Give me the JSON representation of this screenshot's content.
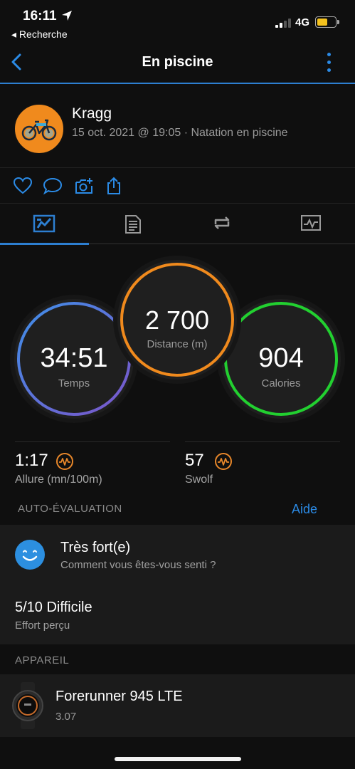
{
  "status_bar": {
    "time": "16:11",
    "back_app": "◂ Recherche",
    "network": "4G",
    "battery_level": 0.5
  },
  "nav": {
    "title": "En piscine"
  },
  "profile": {
    "name": "Kragg",
    "meta": "15 oct. 2021 @ 19:05 · Natation en piscine"
  },
  "tabs": [
    {
      "icon": "stats-icon",
      "active": true
    },
    {
      "icon": "document-icon",
      "active": false
    },
    {
      "icon": "laps-icon",
      "active": false
    },
    {
      "icon": "chart-icon",
      "active": false
    }
  ],
  "summary": {
    "time": {
      "value": "34:51",
      "label": "Temps"
    },
    "distance": {
      "value": "2 700",
      "label": "Distance (m)"
    },
    "calories": {
      "value": "904",
      "label": "Calories"
    }
  },
  "metrics": {
    "pace": {
      "value": "1:17",
      "label": "Allure (mn/100m)"
    },
    "swolf": {
      "value": "57",
      "label": "Swolf"
    }
  },
  "self_eval": {
    "header": "AUTO-ÉVALUATION",
    "help": "Aide",
    "feel_title": "Très fort(e)",
    "feel_subtitle": "Comment vous êtes-vous senti ?",
    "effort_value": "5/10 Difficile",
    "effort_label": "Effort perçu"
  },
  "device": {
    "header": "APPAREIL",
    "name": "Forerunner 945 LTE",
    "version": "3.07"
  },
  "colors": {
    "accent": "#2d7fd1",
    "time_ring": "#4a7fe0",
    "distance_ring": "#f08a1d",
    "calories_ring": "#22d030"
  }
}
